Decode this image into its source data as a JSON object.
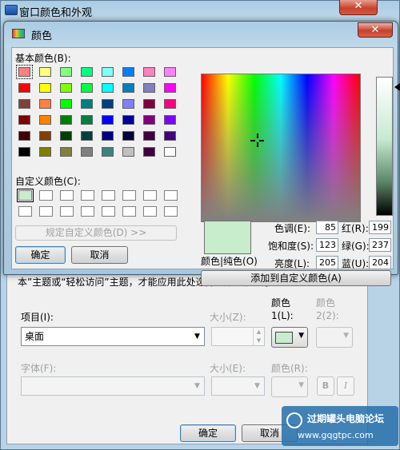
{
  "back_window": {
    "title": "窗口颜色和外观",
    "close_glyph": "✕",
    "note": "本”主题或“轻松访问”主题，才能应用此处选择的颜色和大小。",
    "item_label": "项目(I):",
    "item_value": "桌面",
    "size_label": "大小(Z):",
    "color1_label_a": "颜色",
    "color1_label_b": "1(L):",
    "color2_label_a": "颜色",
    "color2_label_b": "2(2):",
    "color1_value": "#c7edcc",
    "font_label": "字体(F):",
    "font_size_label": "大小(E):",
    "font_color_label": "颜色(R):",
    "bold_label": "B",
    "italic_label": "I",
    "ok_label": "确定",
    "cancel_label": "取消"
  },
  "dialog": {
    "title": "颜色",
    "close_glyph": "✕",
    "basic_colors_label": "基本颜色(B):",
    "custom_colors_label": "自定义颜色(C):",
    "define_custom_label": "规定自定义颜色(D) >>",
    "ok_label": "确定",
    "cancel_label": "取消",
    "color_solid_label": "颜色|纯色(O)",
    "add_custom_label": "添加到自定义颜色(A)",
    "hue_label": "色调(E):",
    "sat_label": "饱和度(S):",
    "lum_label": "亮度(L):",
    "red_label": "红(R):",
    "green_label": "绿(G):",
    "blue_label": "蓝(U):",
    "hue": "85",
    "sat": "123",
    "lum": "205",
    "red": "199",
    "green": "237",
    "blue": "204",
    "current_color": "#c7edcc",
    "basic_colors": [
      [
        "#ff8080",
        "#ffff80",
        "#80ff80",
        "#00ff80",
        "#80ffff",
        "#0080ff",
        "#ff80c0",
        "#ff80ff"
      ],
      [
        "#ff0000",
        "#ffff00",
        "#80ff00",
        "#00ff40",
        "#00ffff",
        "#0080c0",
        "#8080c0",
        "#ff00ff"
      ],
      [
        "#804040",
        "#ff8040",
        "#00ff00",
        "#008080",
        "#004080",
        "#8080ff",
        "#800040",
        "#ff0080"
      ],
      [
        "#800000",
        "#ff8000",
        "#008000",
        "#008040",
        "#0000ff",
        "#0000a0",
        "#800080",
        "#8000ff"
      ],
      [
        "#400000",
        "#804000",
        "#004000",
        "#004040",
        "#000080",
        "#000040",
        "#400040",
        "#400080"
      ],
      [
        "#000000",
        "#808000",
        "#808040",
        "#808080",
        "#408080",
        "#c0c0c0",
        "#400040",
        "#ffffff"
      ]
    ],
    "custom_colors": [
      [
        "#c7edcc",
        "#ffffff",
        "#ffffff",
        "#ffffff",
        "#ffffff",
        "#ffffff",
        "#ffffff",
        "#ffffff"
      ],
      [
        "#ffffff",
        "#ffffff",
        "#ffffff",
        "#ffffff",
        "#ffffff",
        "#ffffff",
        "#ffffff",
        "#ffffff"
      ]
    ]
  },
  "watermark": {
    "line1": "过期罐头电脑论坛",
    "line2": "www.gqgtpc.com"
  }
}
